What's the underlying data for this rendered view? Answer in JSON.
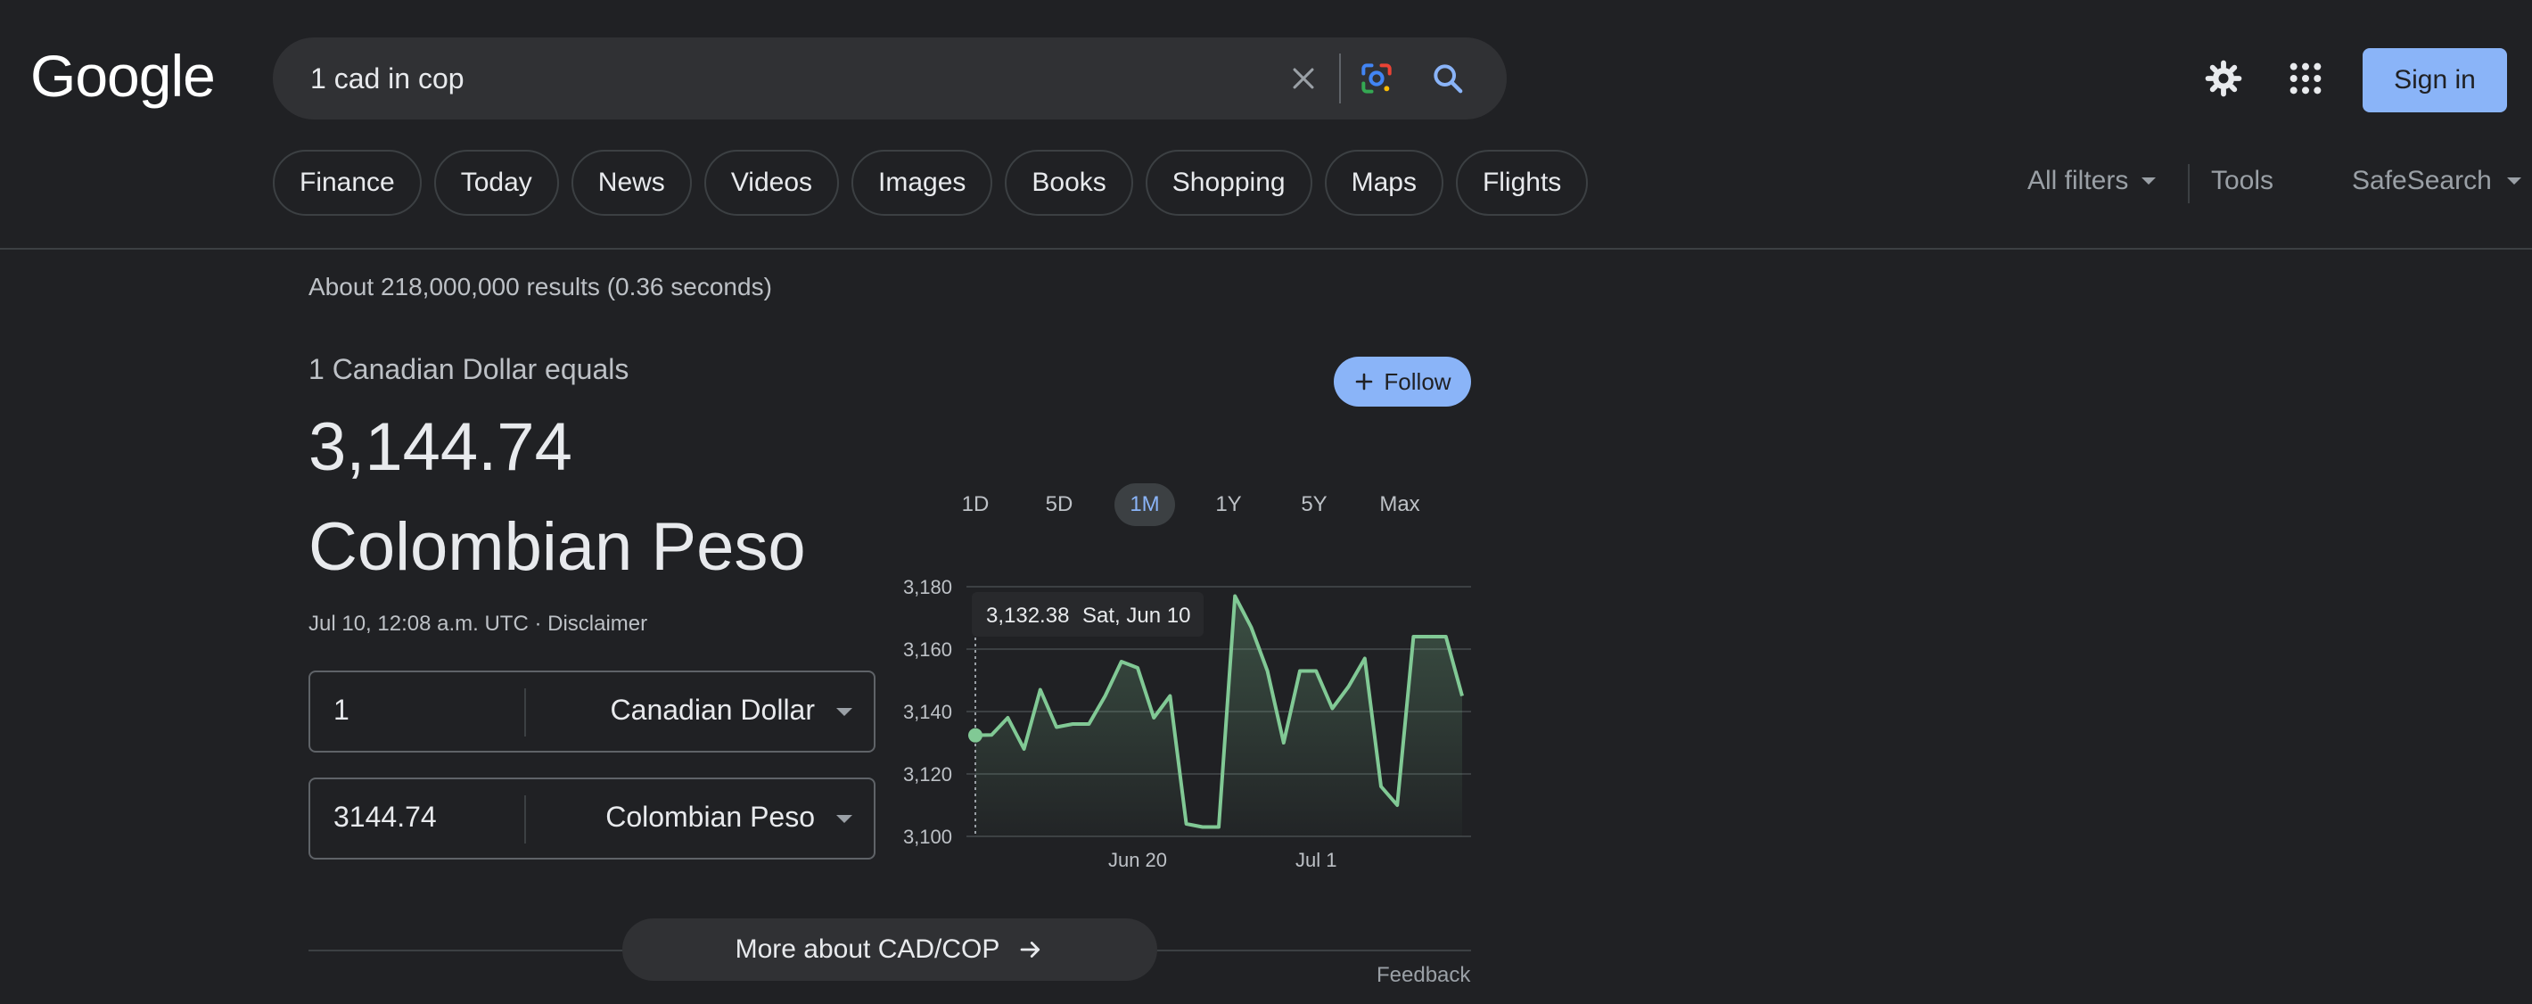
{
  "logo": "Google",
  "search": {
    "query": "1 cad in cop"
  },
  "header": {
    "signin_label": "Sign in"
  },
  "tabs": [
    {
      "label": "Finance"
    },
    {
      "label": "Today"
    },
    {
      "label": "News"
    },
    {
      "label": "Videos"
    },
    {
      "label": "Images"
    },
    {
      "label": "Books"
    },
    {
      "label": "Shopping"
    },
    {
      "label": "Maps"
    },
    {
      "label": "Flights"
    }
  ],
  "filters": {
    "all_filters": "All filters",
    "tools": "Tools",
    "safesearch": "SafeSearch"
  },
  "stats": "About 218,000,000 results (0.36 seconds)",
  "converter": {
    "equals_text": "1 Canadian Dollar equals",
    "result": "3,144.74 Colombian Peso",
    "follow_label": "Follow",
    "timestamp": "Jul 10, 12:08 a.m. UTC",
    "separator": " · ",
    "disclaimer": "Disclaimer",
    "from": {
      "value": "1",
      "currency": "Canadian Dollar"
    },
    "to": {
      "value": "3144.74",
      "currency": "Colombian Peso"
    }
  },
  "ranges": [
    "1D",
    "5D",
    "1M",
    "1Y",
    "5Y",
    "Max"
  ],
  "active_range": "1M",
  "tooltip": {
    "value": "3,132.38",
    "date": "Sat, Jun 10"
  },
  "more_label": "More about CAD/COP",
  "feedback_label": "Feedback",
  "colors": {
    "accent": "#8ab4f8",
    "line": "#81c995",
    "background": "#202124"
  },
  "chart_data": {
    "type": "area",
    "x": [
      "Jun 10",
      "Jun 11",
      "Jun 12",
      "Jun 13",
      "Jun 14",
      "Jun 15",
      "Jun 16",
      "Jun 17",
      "Jun 18",
      "Jun 19",
      "Jun 20",
      "Jun 21",
      "Jun 22",
      "Jun 23",
      "Jun 24",
      "Jun 25",
      "Jun 26",
      "Jun 27",
      "Jun 28",
      "Jun 29",
      "Jun 30",
      "Jul 1",
      "Jul 2",
      "Jul 3",
      "Jul 4",
      "Jul 5",
      "Jul 6",
      "Jul 7",
      "Jul 8",
      "Jul 9",
      "Jul 10"
    ],
    "values": [
      3132.38,
      3132.5,
      3138,
      3128,
      3147,
      3135,
      3136,
      3136,
      3145,
      3156,
      3154,
      3138,
      3145,
      3104,
      3103,
      3103,
      3177,
      3167,
      3153,
      3130,
      3153,
      3153,
      3141,
      3148,
      3157,
      3116,
      3110,
      3164,
      3164,
      3164,
      3145
    ],
    "yticks": [
      3100,
      3120,
      3140,
      3160,
      3180
    ],
    "ytick_labels": [
      "3,100",
      "3,120",
      "3,140",
      "3,160",
      "3,180"
    ],
    "xtick_labels": [
      {
        "label": "Jun 20",
        "index": 10
      },
      {
        "label": "Jul 1",
        "index": 21
      }
    ],
    "ylim": [
      3100,
      3180
    ],
    "grid": true
  }
}
